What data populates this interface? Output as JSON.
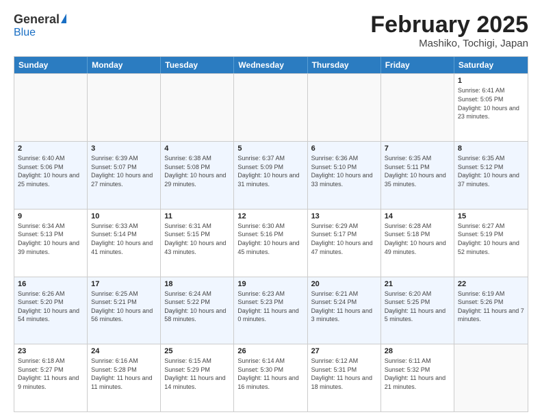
{
  "logo": {
    "general": "General",
    "blue": "Blue"
  },
  "title": {
    "month": "February 2025",
    "location": "Mashiko, Tochigi, Japan"
  },
  "weekdays": [
    "Sunday",
    "Monday",
    "Tuesday",
    "Wednesday",
    "Thursday",
    "Friday",
    "Saturday"
  ],
  "weeks": [
    [
      {
        "day": "",
        "info": ""
      },
      {
        "day": "",
        "info": ""
      },
      {
        "day": "",
        "info": ""
      },
      {
        "day": "",
        "info": ""
      },
      {
        "day": "",
        "info": ""
      },
      {
        "day": "",
        "info": ""
      },
      {
        "day": "1",
        "info": "Sunrise: 6:41 AM\nSunset: 5:05 PM\nDaylight: 10 hours and 23 minutes."
      }
    ],
    [
      {
        "day": "2",
        "info": "Sunrise: 6:40 AM\nSunset: 5:06 PM\nDaylight: 10 hours and 25 minutes."
      },
      {
        "day": "3",
        "info": "Sunrise: 6:39 AM\nSunset: 5:07 PM\nDaylight: 10 hours and 27 minutes."
      },
      {
        "day": "4",
        "info": "Sunrise: 6:38 AM\nSunset: 5:08 PM\nDaylight: 10 hours and 29 minutes."
      },
      {
        "day": "5",
        "info": "Sunrise: 6:37 AM\nSunset: 5:09 PM\nDaylight: 10 hours and 31 minutes."
      },
      {
        "day": "6",
        "info": "Sunrise: 6:36 AM\nSunset: 5:10 PM\nDaylight: 10 hours and 33 minutes."
      },
      {
        "day": "7",
        "info": "Sunrise: 6:35 AM\nSunset: 5:11 PM\nDaylight: 10 hours and 35 minutes."
      },
      {
        "day": "8",
        "info": "Sunrise: 6:35 AM\nSunset: 5:12 PM\nDaylight: 10 hours and 37 minutes."
      }
    ],
    [
      {
        "day": "9",
        "info": "Sunrise: 6:34 AM\nSunset: 5:13 PM\nDaylight: 10 hours and 39 minutes."
      },
      {
        "day": "10",
        "info": "Sunrise: 6:33 AM\nSunset: 5:14 PM\nDaylight: 10 hours and 41 minutes."
      },
      {
        "day": "11",
        "info": "Sunrise: 6:31 AM\nSunset: 5:15 PM\nDaylight: 10 hours and 43 minutes."
      },
      {
        "day": "12",
        "info": "Sunrise: 6:30 AM\nSunset: 5:16 PM\nDaylight: 10 hours and 45 minutes."
      },
      {
        "day": "13",
        "info": "Sunrise: 6:29 AM\nSunset: 5:17 PM\nDaylight: 10 hours and 47 minutes."
      },
      {
        "day": "14",
        "info": "Sunrise: 6:28 AM\nSunset: 5:18 PM\nDaylight: 10 hours and 49 minutes."
      },
      {
        "day": "15",
        "info": "Sunrise: 6:27 AM\nSunset: 5:19 PM\nDaylight: 10 hours and 52 minutes."
      }
    ],
    [
      {
        "day": "16",
        "info": "Sunrise: 6:26 AM\nSunset: 5:20 PM\nDaylight: 10 hours and 54 minutes."
      },
      {
        "day": "17",
        "info": "Sunrise: 6:25 AM\nSunset: 5:21 PM\nDaylight: 10 hours and 56 minutes."
      },
      {
        "day": "18",
        "info": "Sunrise: 6:24 AM\nSunset: 5:22 PM\nDaylight: 10 hours and 58 minutes."
      },
      {
        "day": "19",
        "info": "Sunrise: 6:23 AM\nSunset: 5:23 PM\nDaylight: 11 hours and 0 minutes."
      },
      {
        "day": "20",
        "info": "Sunrise: 6:21 AM\nSunset: 5:24 PM\nDaylight: 11 hours and 3 minutes."
      },
      {
        "day": "21",
        "info": "Sunrise: 6:20 AM\nSunset: 5:25 PM\nDaylight: 11 hours and 5 minutes."
      },
      {
        "day": "22",
        "info": "Sunrise: 6:19 AM\nSunset: 5:26 PM\nDaylight: 11 hours and 7 minutes."
      }
    ],
    [
      {
        "day": "23",
        "info": "Sunrise: 6:18 AM\nSunset: 5:27 PM\nDaylight: 11 hours and 9 minutes."
      },
      {
        "day": "24",
        "info": "Sunrise: 6:16 AM\nSunset: 5:28 PM\nDaylight: 11 hours and 11 minutes."
      },
      {
        "day": "25",
        "info": "Sunrise: 6:15 AM\nSunset: 5:29 PM\nDaylight: 11 hours and 14 minutes."
      },
      {
        "day": "26",
        "info": "Sunrise: 6:14 AM\nSunset: 5:30 PM\nDaylight: 11 hours and 16 minutes."
      },
      {
        "day": "27",
        "info": "Sunrise: 6:12 AM\nSunset: 5:31 PM\nDaylight: 11 hours and 18 minutes."
      },
      {
        "day": "28",
        "info": "Sunrise: 6:11 AM\nSunset: 5:32 PM\nDaylight: 11 hours and 21 minutes."
      },
      {
        "day": "",
        "info": ""
      }
    ]
  ]
}
